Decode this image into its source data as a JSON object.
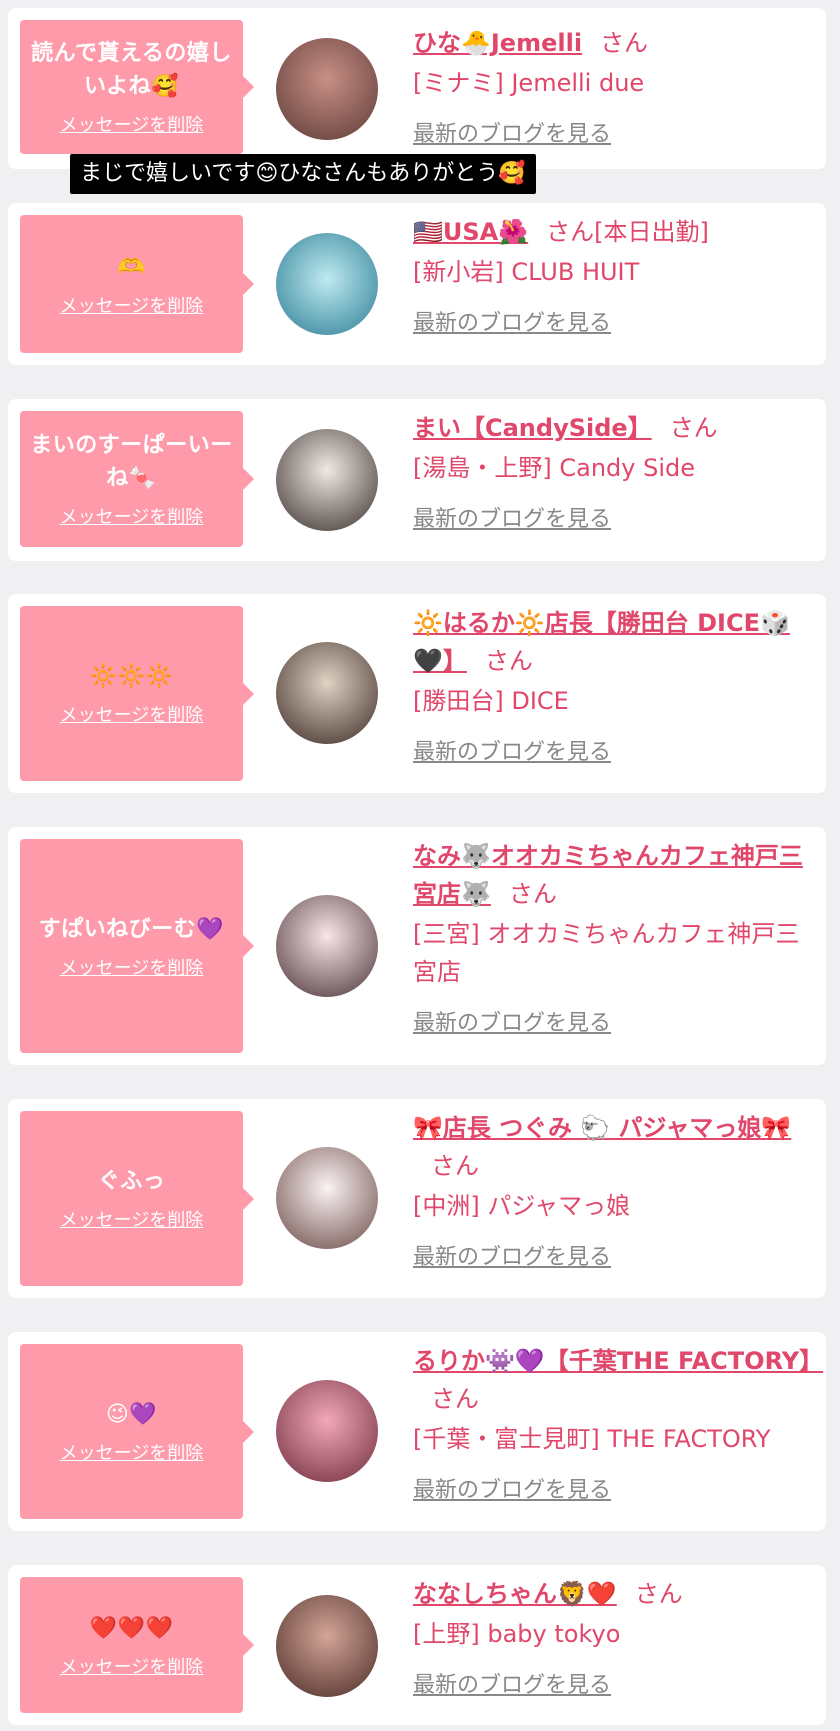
{
  "tooltip": "まじで嬉しいです😊ひなさんもありがとう🥰",
  "delete_label": "メッセージを削除",
  "blog_label": "最新のブログを見る",
  "honorific": "さん",
  "entries": [
    {
      "message": "読んで貰えるの嬉しいよね🥰",
      "name": "ひな🐣Jemelli",
      "name_suffix": "",
      "shop": "[ミナミ] Jemelli due",
      "avatar_colors": [
        "#c98f86",
        "#5b3a35"
      ]
    },
    {
      "message": "🫶",
      "name": "🇺🇸USA🌺",
      "name_suffix": "[本日出勤]",
      "shop": "[新小岩] CLUB HUIT",
      "avatar_colors": [
        "#7fd3e0",
        "#2b7d95"
      ]
    },
    {
      "message": "まいのすーぱーいーね🍬",
      "name": "まい【CandySide】",
      "name_suffix": "",
      "shop": "[湯島・上野] Candy Side",
      "avatar_colors": [
        "#d8d2cc",
        "#3a2f2c"
      ]
    },
    {
      "message": "🔆🔆🔆",
      "name": "🔆はるか🔆店長【勝田台 DICE🎲🖤】",
      "name_suffix": "",
      "shop": "[勝田台] DICE",
      "avatar_colors": [
        "#c9b8a8",
        "#3b2a24"
      ]
    },
    {
      "message": "すぱいねびーむ💜",
      "name": "なみ🐺オオカミちゃんカフェ神戸三宮店🐺",
      "name_suffix": "",
      "shop": "[三宮] オオカミちゃんカフェ神戸三宮店",
      "avatar_colors": [
        "#f0d6d8",
        "#4a3236"
      ]
    },
    {
      "message": "ぐふっ",
      "name": "🎀店長 つぐみ 🐑 パジャマっ娘🎀",
      "name_suffix": "",
      "shop": "[中洲] パジャマっ娘",
      "avatar_colors": [
        "#f3e7ea",
        "#6a4a46"
      ]
    },
    {
      "message": "😉💜",
      "name": "るりか👾💜【千葉THE FACTORY】",
      "name_suffix": "",
      "shop": "[千葉・富士見町] THE FACTORY",
      "avatar_colors": [
        "#e88aa0",
        "#6e2c3b"
      ]
    },
    {
      "message": "❤️❤️❤️",
      "name": "ななしちゃん🦁❤️",
      "name_suffix": "",
      "shop": "[上野] baby tokyo",
      "avatar_colors": [
        "#b8877a",
        "#4a2b26"
      ]
    }
  ]
}
